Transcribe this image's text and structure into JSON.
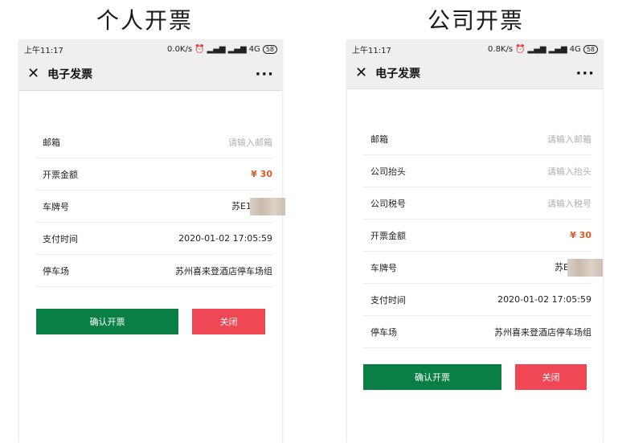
{
  "left": {
    "heading": "个人开票",
    "status": {
      "time": "上午11:17",
      "speed": "0.0K/s",
      "net": "4G",
      "battery": "58"
    },
    "nav": {
      "title": "电子发票",
      "more": "···"
    },
    "fields": {
      "email_label": "邮箱",
      "email_placeholder": "请输入邮箱",
      "amount_label": "开票金额",
      "amount_value": "¥ 30",
      "plate_label": "车牌号",
      "plate_value": "苏E1",
      "paytime_label": "支付时间",
      "paytime_value": "2020-01-02 17:05:59",
      "lot_label": "停车场",
      "lot_value": "苏州喜来登酒店停车场组"
    },
    "buttons": {
      "confirm": "确认开票",
      "close": "关闭"
    }
  },
  "right": {
    "heading": "公司开票",
    "status": {
      "time": "上午11:17",
      "speed": "0.8K/s",
      "net": "4G",
      "battery": "58"
    },
    "nav": {
      "title": "电子发票",
      "more": "···"
    },
    "fields": {
      "email_label": "邮箱",
      "email_placeholder": "请输入邮箱",
      "company_label": "公司抬头",
      "company_placeholder": "请输入抬头",
      "tax_label": "公司税号",
      "tax_placeholder": "请输入税号",
      "amount_label": "开票金额",
      "amount_value": "¥ 30",
      "plate_label": "车牌号",
      "plate_value": "苏E",
      "paytime_label": "支付时间",
      "paytime_value": "2020-01-02 17:05:59",
      "lot_label": "停车场",
      "lot_value": "苏州喜来登酒店停车场组"
    },
    "buttons": {
      "confirm": "确认开票",
      "close": "关闭"
    }
  }
}
